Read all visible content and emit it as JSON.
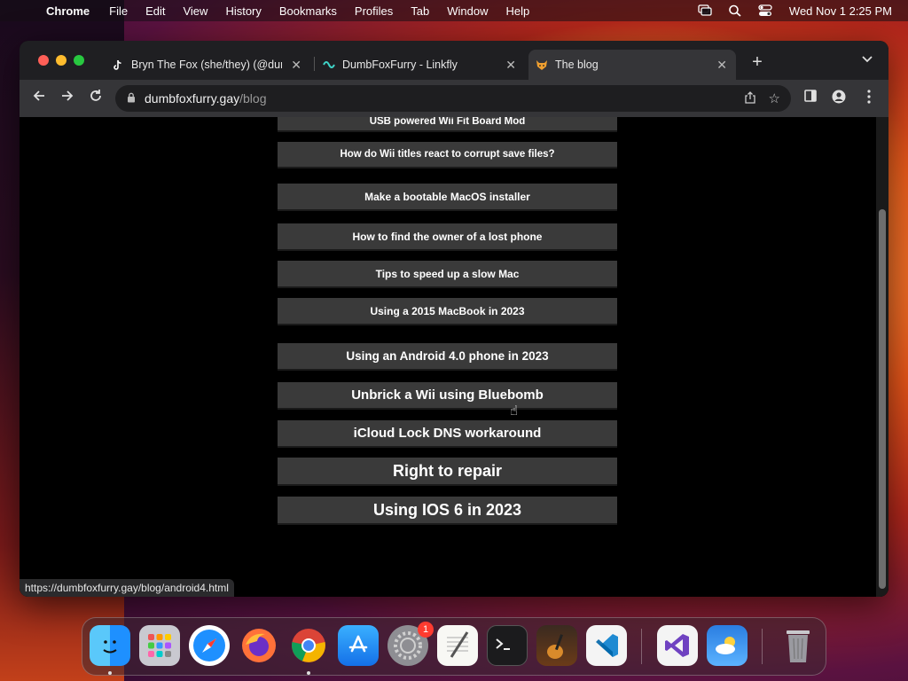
{
  "menubar": {
    "app_name": "Chrome",
    "items": [
      "File",
      "Edit",
      "View",
      "History",
      "Bookmarks",
      "Profiles",
      "Tab",
      "Window",
      "Help"
    ],
    "clock": "Wed Nov 1  2:25 PM"
  },
  "tabs": [
    {
      "title": "Bryn The Fox (she/they) (@dumbfoxfurry)",
      "favicon": "tiktok-icon",
      "active": false
    },
    {
      "title": "DumbFoxFurry - Linkfly",
      "favicon": "linkfly-icon",
      "active": false
    },
    {
      "title": "The blog",
      "favicon": "fox-icon",
      "active": true
    }
  ],
  "omnibox": {
    "host": "dumbfoxfurry.gay",
    "path": "/blog"
  },
  "blog": {
    "posts": [
      "USB powered Wii Fit Board Mod",
      "How do Wii titles react to corrupt save files?",
      "Make a bootable MacOS installer",
      "How to find the owner of a lost phone",
      "Tips to speed up a slow Mac",
      "Using a 2015 MacBook in 2023",
      "Using an Android 4.0 phone in 2023",
      "Unbrick a Wii using Bluebomb",
      "iCloud Lock DNS workaround",
      "Right to repair",
      "Using IOS 6 in 2023"
    ]
  },
  "status_url": "https://dumbfoxfurry.gay/blog/android4.html",
  "dock": {
    "apps": [
      "Finder",
      "Launchpad",
      "Safari",
      "Firefox",
      "Chrome",
      "App Store",
      "System Settings",
      "TextEdit",
      "Terminal",
      "GarageBand",
      "Visual Studio Code",
      "Visual Studio",
      "Weather",
      "Trash"
    ],
    "system_settings_badge": "1"
  }
}
